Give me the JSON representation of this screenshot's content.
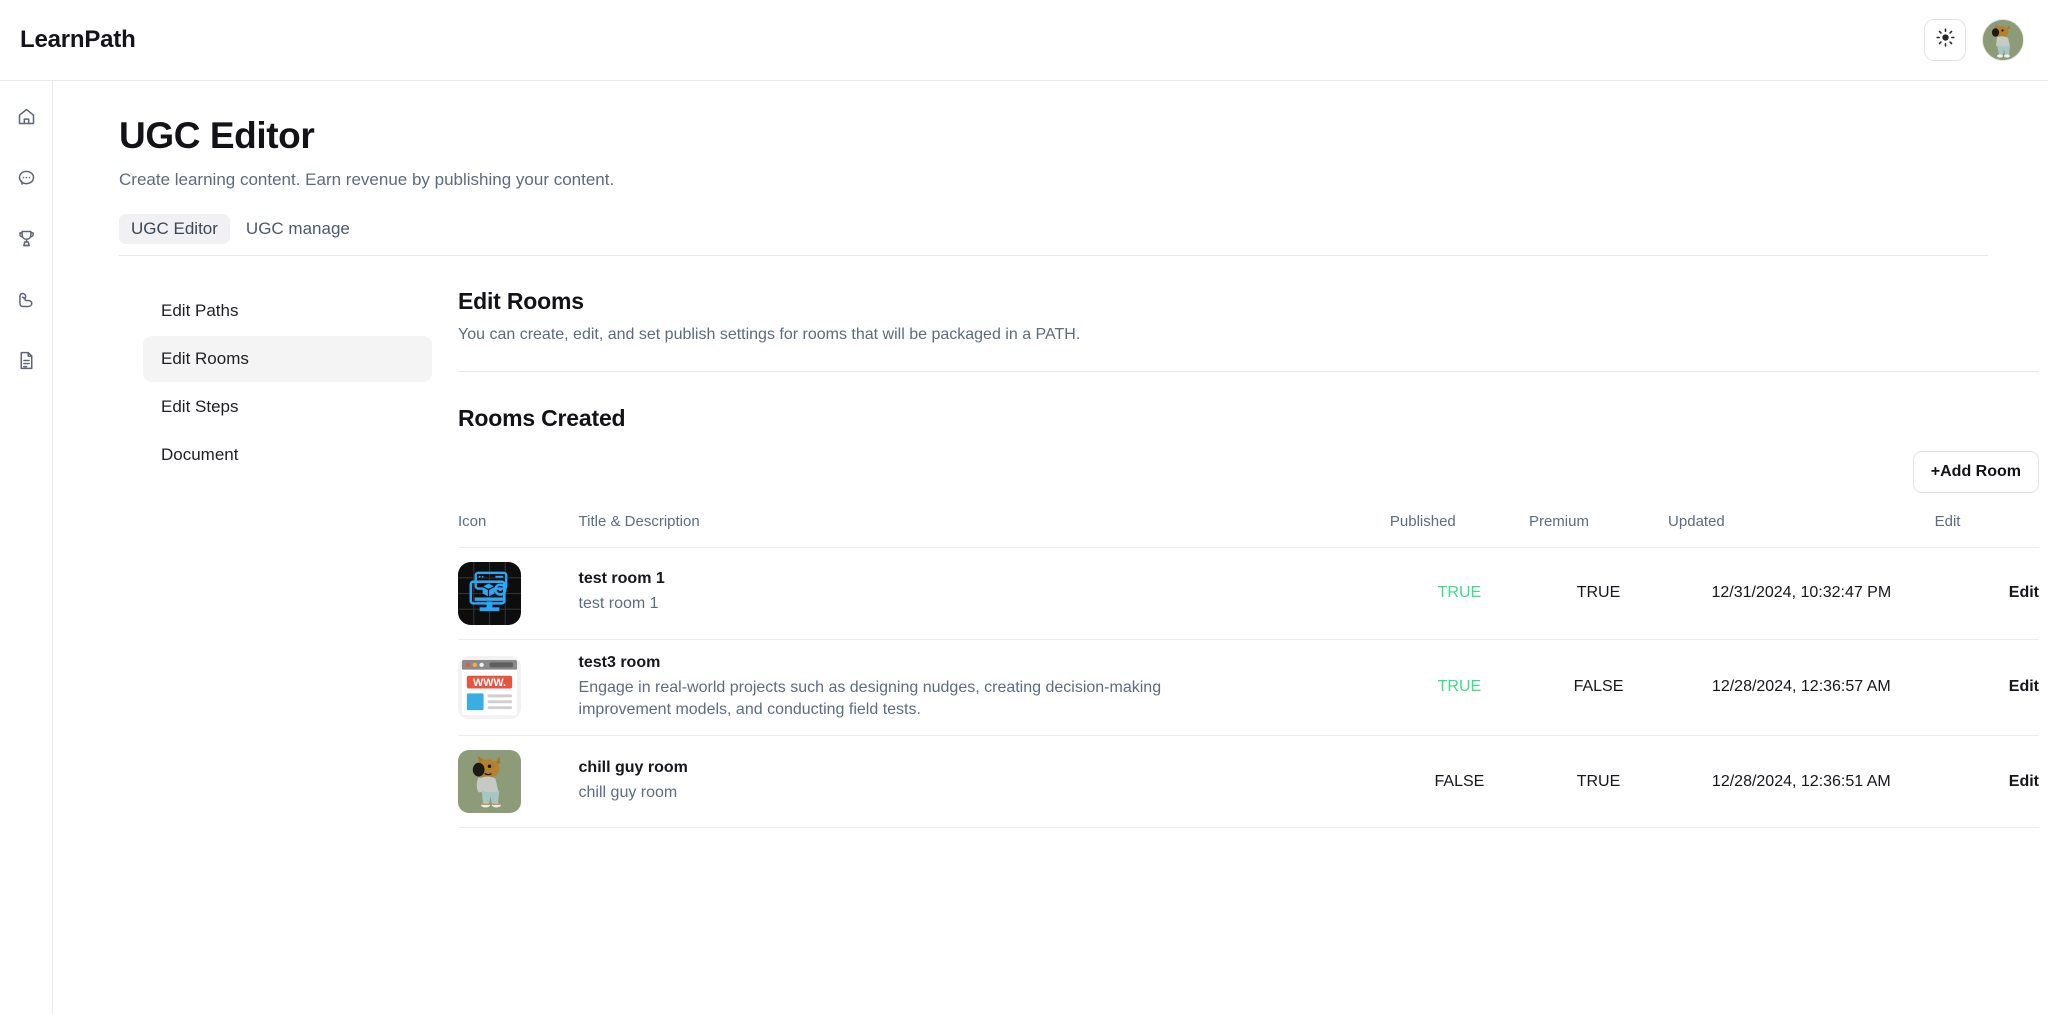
{
  "app": {
    "brand": "LearnPath"
  },
  "topbar": {
    "theme_toggle_icon": "sun-icon",
    "avatar_icon": "user-avatar"
  },
  "rail": {
    "items": [
      {
        "icon": "home-icon",
        "label": "Home"
      },
      {
        "icon": "chat-icon",
        "label": "Chat"
      },
      {
        "icon": "trophy-icon",
        "label": "Achievements"
      },
      {
        "icon": "muscle-icon",
        "label": "Training"
      },
      {
        "icon": "document-icon",
        "label": "Documents"
      }
    ]
  },
  "header": {
    "title": "UGC Editor",
    "subtitle": "Create learning content. Earn revenue by publishing your content."
  },
  "tabs": [
    {
      "label": "UGC Editor",
      "active": true
    },
    {
      "label": "UGC manage",
      "active": false
    }
  ],
  "sidenav": {
    "items": [
      {
        "label": "Edit Paths",
        "active": false
      },
      {
        "label": "Edit Rooms",
        "active": true
      },
      {
        "label": "Edit Steps",
        "active": false
      },
      {
        "label": "Document",
        "active": false
      }
    ]
  },
  "section": {
    "title": "Edit Rooms",
    "description": "You can create, edit, and set publish settings for rooms that will be packaged in a PATH."
  },
  "rooms_panel": {
    "title": "Rooms Created",
    "add_button": "+Add Room"
  },
  "table": {
    "headers": {
      "icon": "Icon",
      "title": "Title & Description",
      "published": "Published",
      "premium": "Premium",
      "updated": "Updated",
      "edit": "Edit"
    },
    "rows": [
      {
        "icon": "monitor-cube-gear-icon",
        "name": "test room 1",
        "description": "test room 1",
        "published": "TRUE",
        "published_state": "true",
        "premium": "TRUE",
        "updated": "12/31/2024, 10:32:47 PM",
        "edit": "Edit"
      },
      {
        "icon": "browser-www-icon",
        "name": "test3 room",
        "description": "Engage in real-world projects such as designing nudges, creating decision-making improvement models, and conducting field tests.",
        "published": "TRUE",
        "published_state": "true",
        "premium": "FALSE",
        "updated": "12/28/2024, 12:36:57 AM",
        "edit": "Edit"
      },
      {
        "icon": "chill-guy-dog-icon",
        "name": "chill guy room",
        "description": "chill guy room",
        "published": "FALSE",
        "published_state": "false",
        "premium": "TRUE",
        "updated": "12/28/2024, 12:36:51 AM",
        "edit": "Edit"
      }
    ]
  },
  "colors": {
    "published_true": "#3ddc84",
    "text_primary": "#16161c",
    "text_muted": "#5d6b83",
    "active_pill": "#f1f1f3",
    "border": "#ececee"
  }
}
